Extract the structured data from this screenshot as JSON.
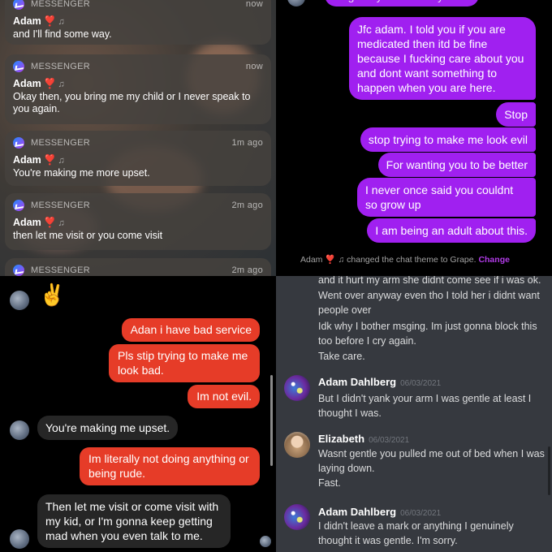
{
  "notifications": [
    {
      "app": "MESSENGER",
      "time": "now",
      "sender": "Adam",
      "emoji": "❣️",
      "note": "♫",
      "body": "and I'll find some way."
    },
    {
      "app": "MESSENGER",
      "time": "now",
      "sender": "Adam",
      "emoji": "❣️",
      "note": "♫",
      "body": "Okay then, you bring me my child or I never speak to you again."
    },
    {
      "app": "MESSENGER",
      "time": "1m ago",
      "sender": "Adam",
      "emoji": "❣️",
      "note": "♫",
      "body": "You're making me more upset."
    },
    {
      "app": "MESSENGER",
      "time": "2m ago",
      "sender": "Adam",
      "emoji": "❣️",
      "note": "♫",
      "body": "then let me visit or you come visit"
    },
    {
      "app": "MESSENGER",
      "time": "2m ago"
    }
  ],
  "purple_chat": {
    "top_fragment": "To get my child from you.",
    "messages": [
      "Jfc adam. I told you if you are medicated then itd be fine because I fucking care about you and dont want something to happen when you are here.",
      "Stop",
      "stop trying to make me look evil",
      "For wanting you to be better",
      "I never once said you couldnt so grow up",
      "I am being an adult about this."
    ],
    "theme_note": {
      "name": "Adam",
      "emoji": "❣️",
      "note": "♫",
      "text": "changed the chat theme to Grape.",
      "action": "Change"
    }
  },
  "red_chat": {
    "emoji": "✌️",
    "sent": [
      "Adan i have bad service",
      "Pls stip trying to make me look bad.",
      "Im not evil.",
      "Im literally not doing anything or being rude."
    ],
    "received": [
      "You're making me upset.",
      "Then let me visit or come visit with my kid, or I'm gonna keep getting mad when you even talk to me."
    ]
  },
  "discord": {
    "lines_top": [
      "and it hurt my arm she didnt come see if i was ok.",
      "Went over anyway even tho I told her i didnt want people over",
      "Idk why I bother msging. Im just gonna block this too before I cry again.",
      "Take care."
    ],
    "messages": [
      {
        "author": "Adam Dahlberg",
        "date": "06/03/2021",
        "lines": [
          "But I didn't yank your arm I was gentle at least I thought I was."
        ]
      },
      {
        "author": "Elizabeth",
        "date": "06/03/2021",
        "lines": [
          "Wasnt gentle you pulled me out of bed when I was laying down.",
          "Fast."
        ]
      },
      {
        "author": "Adam Dahlberg",
        "date": "06/03/2021",
        "lines": [
          "I didn't leave a mark or anything I genuinely thought it was gentle. I'm sorry."
        ]
      }
    ]
  },
  "colors": {
    "messenger_grape": "#a020f0",
    "messenger_red": "#e63c28",
    "discord_bg": "#36393f"
  }
}
